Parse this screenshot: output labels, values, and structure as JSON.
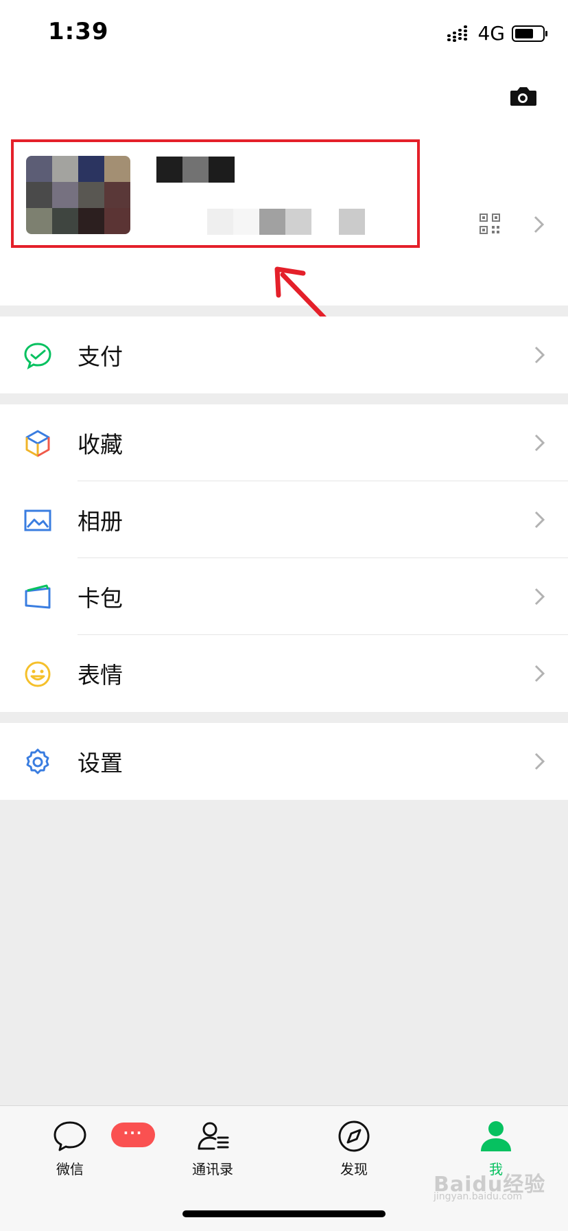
{
  "status_bar": {
    "time": "1:39",
    "network": "4G",
    "battery_level": 0.75
  },
  "profile": {
    "name_redacted": true,
    "wechat_id_redacted": true
  },
  "menu": {
    "pay": "支付",
    "favorites": "收藏",
    "album": "相册",
    "cards": "卡包",
    "stickers": "表情",
    "settings": "设置"
  },
  "tabbar": {
    "chats": "微信",
    "contacts": "通讯录",
    "discover": "发现",
    "me": "我",
    "chats_badge": "···",
    "active": "me"
  },
  "watermark": {
    "text": "Baidu经验",
    "sub": "jingyan.baidu.com"
  },
  "colors": {
    "highlight": "#e4202a",
    "active_tab": "#07c160",
    "badge": "#fa5151",
    "background": "#ededed"
  }
}
